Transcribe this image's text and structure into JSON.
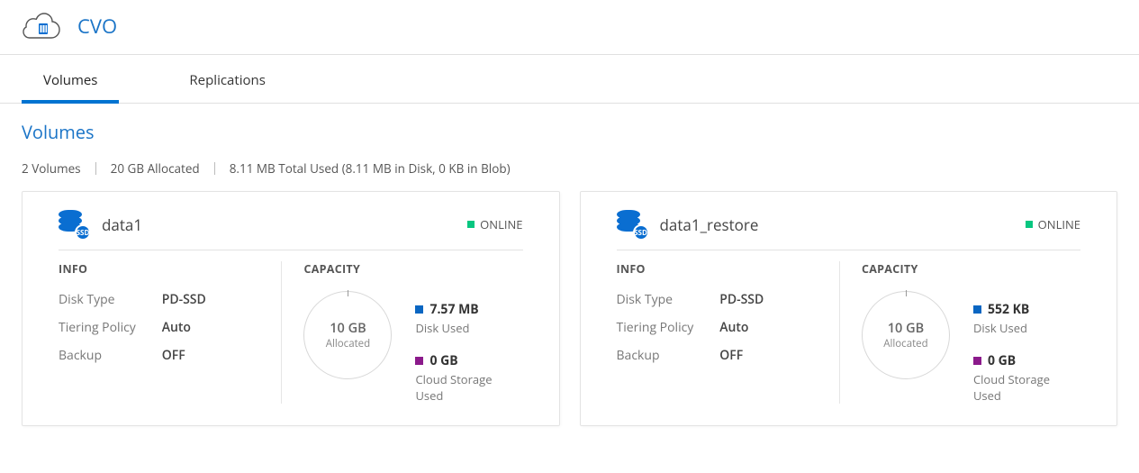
{
  "header": {
    "title": "CVO"
  },
  "tabs": [
    {
      "label": "Volumes",
      "active": true
    },
    {
      "label": "Replications",
      "active": false
    }
  ],
  "section": {
    "heading": "Volumes"
  },
  "stats": {
    "count": "2 Volumes",
    "allocated": "20 GB Allocated",
    "used": "8.11 MB Total Used (8.11 MB in Disk, 0 KB in Blob)"
  },
  "info_labels": {
    "info_heading": "INFO",
    "capacity_heading": "CAPACITY",
    "disk_type": "Disk Type",
    "tiering_policy": "Tiering Policy",
    "backup": "Backup",
    "allocated": "Allocated",
    "disk_used": "Disk Used",
    "cloud_used": "Cloud Storage Used"
  },
  "volumes": [
    {
      "name": "data1",
      "status": "ONLINE",
      "disk_type": "PD-SSD",
      "tiering_policy": "Auto",
      "backup": "OFF",
      "allocated": "10 GB",
      "disk_used": "7.57 MB",
      "cloud_used": "0 GB"
    },
    {
      "name": "data1_restore",
      "status": "ONLINE",
      "disk_type": "PD-SSD",
      "tiering_policy": "Auto",
      "backup": "OFF",
      "allocated": "10 GB",
      "disk_used": "552 KB",
      "cloud_used": "0 GB"
    }
  ]
}
